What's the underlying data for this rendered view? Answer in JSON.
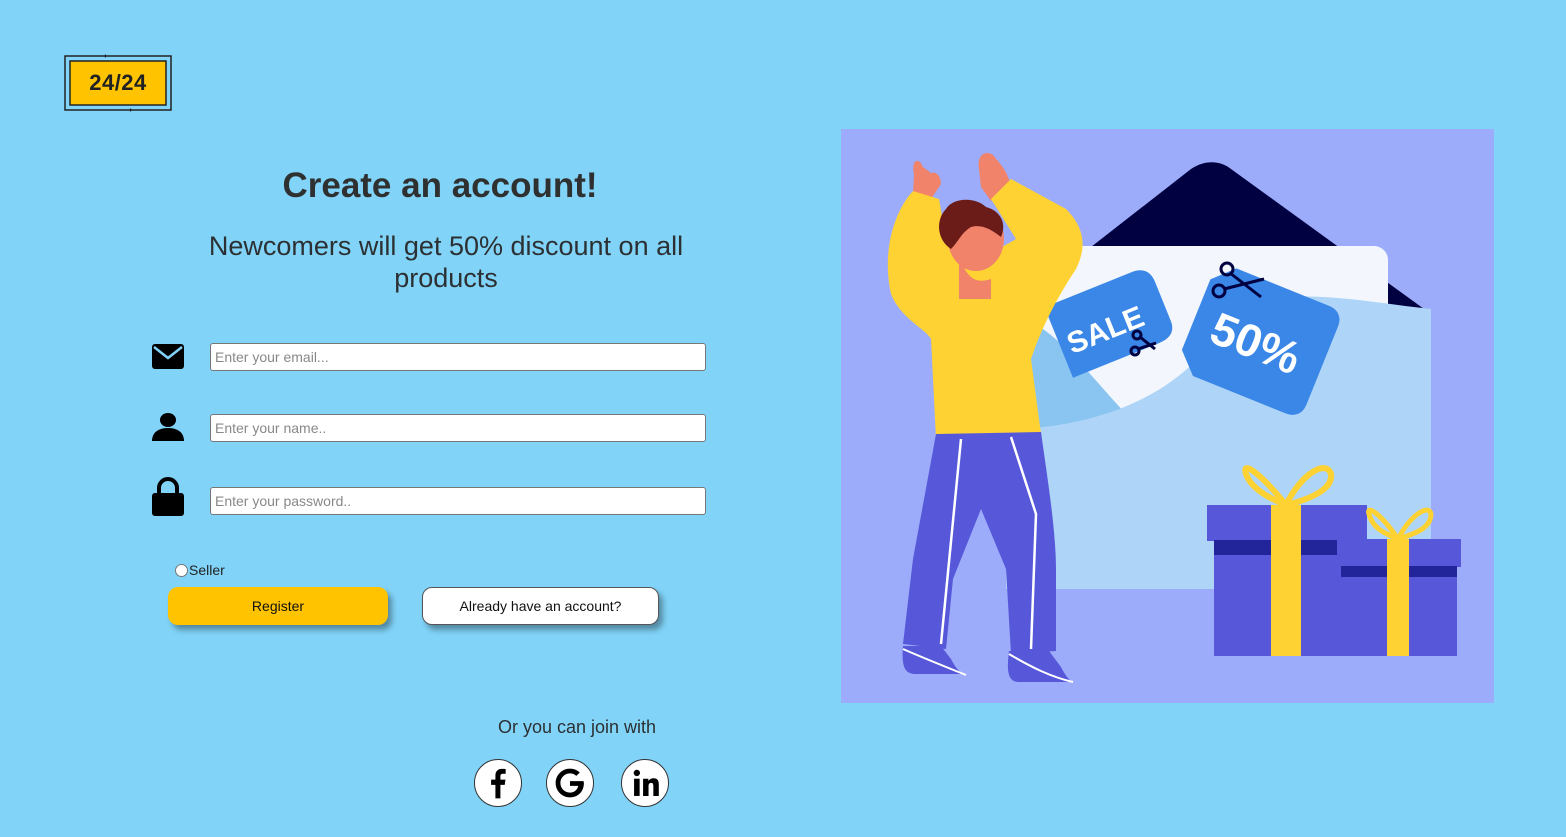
{
  "logo": {
    "text": "24/24",
    "color": "#ffc300"
  },
  "form": {
    "title": "Create an account!",
    "subtitle": "Newcomers will get 50% discount on all products",
    "email": {
      "placeholder": "Enter your email...",
      "icon": "envelope-icon"
    },
    "name": {
      "placeholder": "Enter your name..",
      "icon": "user-icon"
    },
    "password": {
      "placeholder": "Enter your password..",
      "icon": "lock-icon"
    },
    "seller_label": "Seller",
    "register_label": "Register",
    "login_label": "Already have an account?"
  },
  "social": {
    "join_text": "Or you can join with",
    "items": [
      {
        "name": "facebook",
        "icon": "facebook-icon"
      },
      {
        "name": "google",
        "icon": "google-icon"
      },
      {
        "name": "linkedin",
        "icon": "linkedin-icon"
      }
    ]
  },
  "illustration": {
    "sale_tag": "SALE",
    "discount_tag": "50%",
    "background_color": "#9cacfa"
  },
  "colors": {
    "page_background": "#81d3f8",
    "accent": "#ffc300",
    "text": "#2f3030"
  }
}
